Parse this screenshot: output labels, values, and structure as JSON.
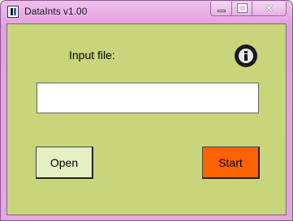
{
  "window": {
    "title": "DataInts v1.00",
    "app_icon": "app-icon",
    "controls": {
      "minimize_icon": "minimize-icon",
      "maximize_icon": "maximize-icon",
      "close_icon": "close-icon",
      "close_glyph": "✕"
    }
  },
  "form": {
    "input_label": "Input file:",
    "input_value": "",
    "input_placeholder": "",
    "info_icon": "info-icon",
    "open_label": "Open",
    "start_label": "Start"
  },
  "colors": {
    "client_background": "#c8d57b",
    "titlebar": "#e3a0e1",
    "open_button": "#e5f0c3",
    "start_button": "#ff6300"
  }
}
